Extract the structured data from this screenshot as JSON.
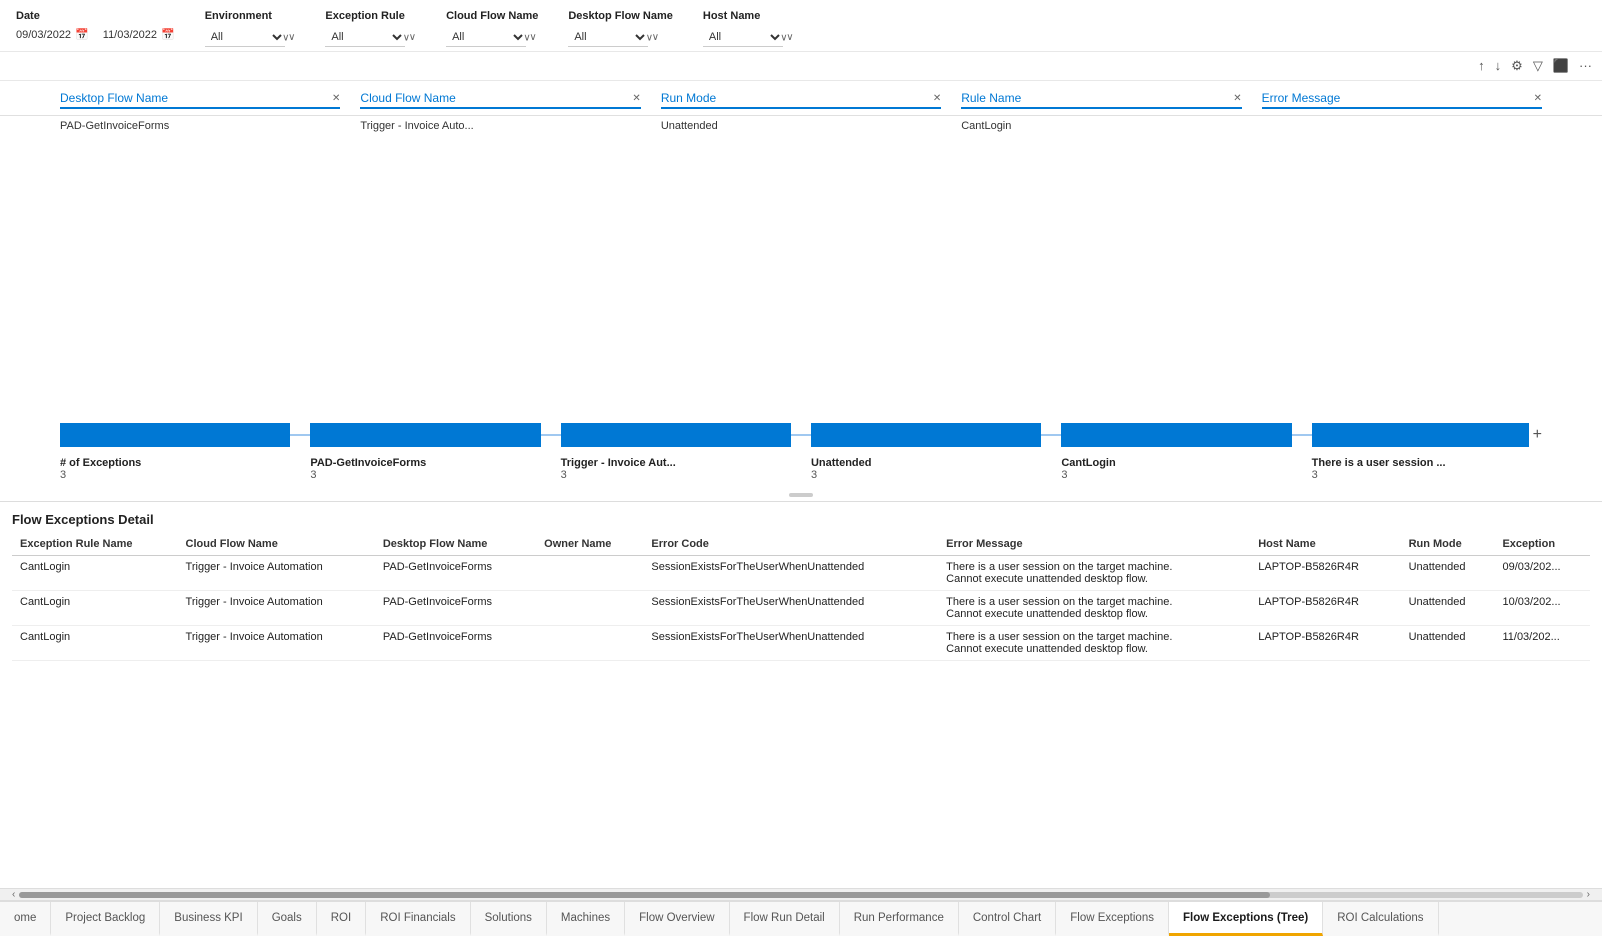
{
  "filters": {
    "date_label": "Date",
    "date_from": "09/03/2022",
    "date_to": "11/03/2022",
    "environment_label": "Environment",
    "environment_value": "All",
    "exception_rule_label": "Exception Rule",
    "exception_rule_value": "All",
    "cloud_flow_label": "Cloud Flow Name",
    "cloud_flow_value": "All",
    "desktop_flow_label": "Desktop Flow Name",
    "desktop_flow_value": "All",
    "host_name_label": "Host Name",
    "host_name_value": "All"
  },
  "sankey": {
    "headers": [
      {
        "label": "Desktop Flow Name",
        "value": "PAD-GetInvoiceForms"
      },
      {
        "label": "Cloud Flow Name",
        "value": "Trigger - Invoice Auto..."
      },
      {
        "label": "Run Mode",
        "value": "Unattended"
      },
      {
        "label": "Rule Name",
        "value": "CantLogin"
      },
      {
        "label": "Error Message",
        "value": ""
      }
    ],
    "nodes": [
      {
        "label": "# of Exceptions",
        "count": "3"
      },
      {
        "label": "PAD-GetInvoiceForms",
        "count": "3"
      },
      {
        "label": "Trigger - Invoice Aut...",
        "count": "3"
      },
      {
        "label": "Unattended",
        "count": "3"
      },
      {
        "label": "CantLogin",
        "count": "3"
      },
      {
        "label": "There is a user session ...",
        "count": "3"
      }
    ]
  },
  "detail": {
    "title": "Flow Exceptions Detail",
    "columns": [
      "Exception Rule Name",
      "Cloud Flow Name",
      "Desktop Flow Name",
      "Owner Name",
      "Error Code",
      "Error Message",
      "Host Name",
      "Run Mode",
      "Exception"
    ],
    "rows": [
      {
        "exception_rule": "CantLogin",
        "cloud_flow": "Trigger - Invoice Automation",
        "desktop_flow": "PAD-GetInvoiceForms",
        "owner": "",
        "error_code": "SessionExistsForTheUserWhenUnattended",
        "error_message": "There is a user session on the target machine. Cannot execute unattended desktop flow.",
        "host_name": "LAPTOP-B5826R4R",
        "run_mode": "Unattended",
        "exception": "09/03/202..."
      },
      {
        "exception_rule": "CantLogin",
        "cloud_flow": "Trigger - Invoice Automation",
        "desktop_flow": "PAD-GetInvoiceForms",
        "owner": "",
        "error_code": "SessionExistsForTheUserWhenUnattended",
        "error_message": "There is a user session on the target machine. Cannot execute unattended desktop flow.",
        "host_name": "LAPTOP-B5826R4R",
        "run_mode": "Unattended",
        "exception": "10/03/202..."
      },
      {
        "exception_rule": "CantLogin",
        "cloud_flow": "Trigger - Invoice Automation",
        "desktop_flow": "PAD-GetInvoiceForms",
        "owner": "",
        "error_code": "SessionExistsForTheUserWhenUnattended",
        "error_message": "There is a user session on the target machine. Cannot execute unattended desktop flow.",
        "host_name": "LAPTOP-B5826R4R",
        "run_mode": "Unattended",
        "exception": "11/03/202..."
      }
    ]
  },
  "tabs": [
    {
      "label": "ome",
      "active": false
    },
    {
      "label": "Project Backlog",
      "active": false
    },
    {
      "label": "Business KPI",
      "active": false
    },
    {
      "label": "Goals",
      "active": false
    },
    {
      "label": "ROI",
      "active": false
    },
    {
      "label": "ROI Financials",
      "active": false
    },
    {
      "label": "Solutions",
      "active": false
    },
    {
      "label": "Machines",
      "active": false
    },
    {
      "label": "Flow Overview",
      "active": false
    },
    {
      "label": "Flow Run Detail",
      "active": false
    },
    {
      "label": "Run Performance",
      "active": false
    },
    {
      "label": "Control Chart",
      "active": false
    },
    {
      "label": "Flow Exceptions",
      "active": false
    },
    {
      "label": "Flow Exceptions (Tree)",
      "active": true
    },
    {
      "label": "ROI Calculations",
      "active": false
    }
  ],
  "toolbar": {
    "sort_asc": "↑",
    "sort_desc": "↓",
    "hierarchy": "⚙",
    "filter": "⊿",
    "export": "⬜",
    "more": "···"
  },
  "scroll": {
    "left_arrow": "‹",
    "right_arrow": "›"
  }
}
